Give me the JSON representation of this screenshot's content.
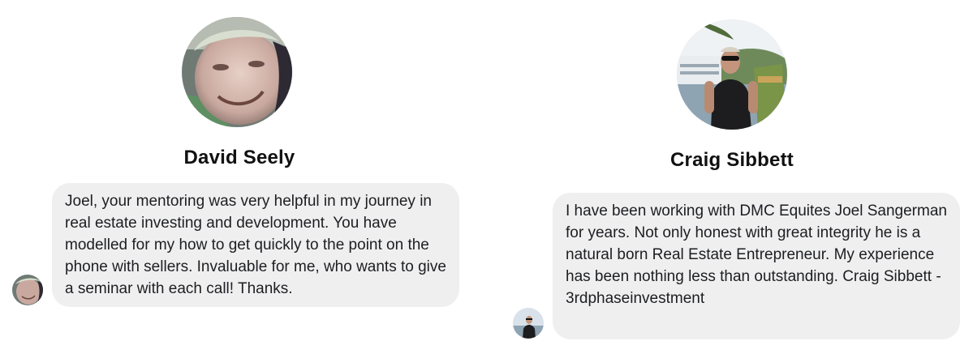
{
  "testimonials": [
    {
      "name": "David Seely",
      "text": "Joel, your mentoring was very helpful in my journey in real estate investing and development.  You have modelled for my how to get quickly to the point on the phone with sellers.  Invaluable for me, who wants to give a seminar with each call!  Thanks."
    },
    {
      "name": "Craig Sibbett",
      "text": "I have been working with DMC Equites Joel Sangerman for years.   Not only honest with great integrity he is a natural born Real Estate Entrepreneur.   My experience has been nothing less than outstanding.   Craig Sibbett - 3rdphaseinvestment"
    }
  ],
  "colors": {
    "bubble_bg": "#f0eff0",
    "name_text": "#111111",
    "body_text": "#1c1e21"
  }
}
